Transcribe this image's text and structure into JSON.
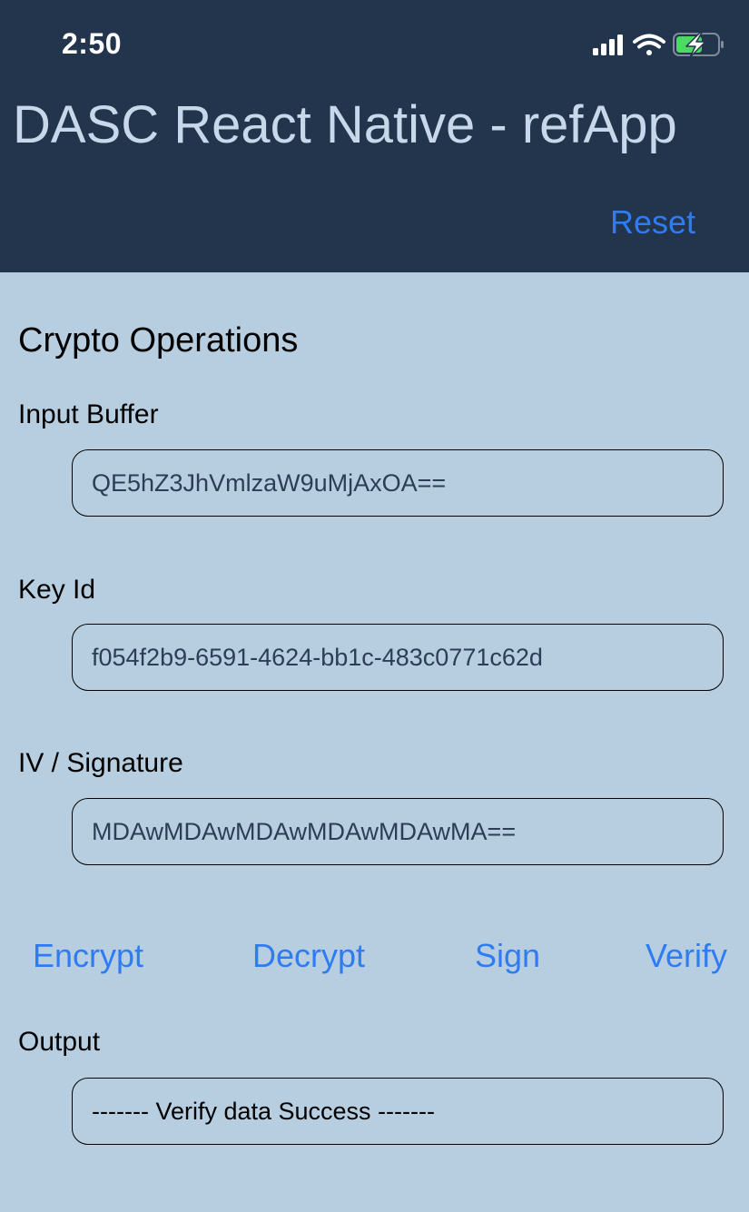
{
  "status_bar": {
    "time": "2:50",
    "icons": [
      "cellular-signal-icon",
      "wifi-icon",
      "battery-charging-icon"
    ]
  },
  "header": {
    "title": "DASC React Native - refApp",
    "reset_label": "Reset"
  },
  "section": {
    "title": "Crypto Operations"
  },
  "fields": {
    "input_buffer": {
      "label": "Input Buffer",
      "value": "QE5hZ3JhVmlzaW9uMjAxOA=="
    },
    "key_id": {
      "label": "Key Id",
      "value": "f054f2b9-6591-4624-bb1c-483c0771c62d"
    },
    "iv_signature": {
      "label": "IV / Signature",
      "value": "MDAwMDAwMDAwMDAwMDAwMA=="
    },
    "output": {
      "label": "Output",
      "value": "------- Verify data Success -------"
    }
  },
  "actions": {
    "encrypt": "Encrypt",
    "decrypt": "Decrypt",
    "sign": "Sign",
    "verify": "Verify"
  },
  "colors": {
    "header_bg": "#22354d",
    "page_bg": "#b7cee1",
    "accent": "#2f7cf2",
    "title_text": "#c6d8ea",
    "battery_fill": "#4cd964"
  }
}
